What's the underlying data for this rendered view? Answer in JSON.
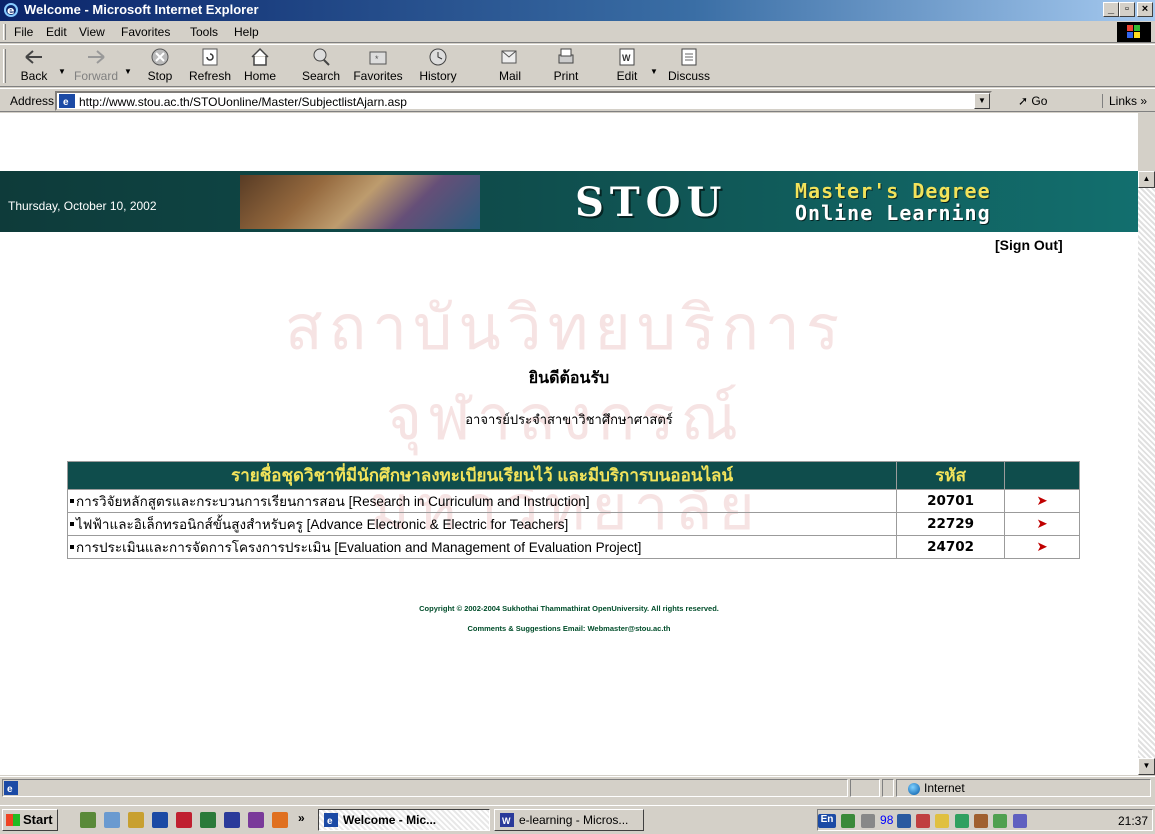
{
  "window": {
    "title": "Welcome - Microsoft Internet Explorer",
    "controls": {
      "minimize": "_",
      "maximize": "▫",
      "close": "×"
    }
  },
  "menu": [
    "File",
    "Edit",
    "View",
    "Favorites",
    "Tools",
    "Help"
  ],
  "toolbar": {
    "back": "Back",
    "forward": "Forward",
    "stop": "Stop",
    "refresh": "Refresh",
    "home": "Home",
    "search": "Search",
    "favorites": "Favorites",
    "history": "History",
    "mail": "Mail",
    "print": "Print",
    "edit": "Edit",
    "discuss": "Discuss"
  },
  "address": {
    "label": "Address",
    "url": "http://www.stou.ac.th/STOUonline/Master/SubjectlistAjarn.asp",
    "go": "Go",
    "links": "Links"
  },
  "banner": {
    "date": "Thursday, October 10, 2002",
    "brand": "STOU",
    "tagline_1": "Master's Degree",
    "tagline_2": "Online Learning"
  },
  "page": {
    "sign_out": "[Sign Out]",
    "welcome": "ยินดีต้อนรับ",
    "role": "อาจารย์ประจำสาขาวิชาศึกษาศาสตร์",
    "watermark_1": "สถาบันวิทยบริการ",
    "watermark_2": "จุฬาลงกรณ์มหาวิทยาลัย"
  },
  "subjects": {
    "header_title": "รายชื่อชุดวิชาที่มีนักศึกษาลงทะเบียนเรียนไว้ และมีบริการบนออนไลน์",
    "header_code": "รหัส",
    "rows": [
      {
        "name": "การวิจัยหลักสูตรและกระบวนการเรียนการสอน [Research in Curriculum and Instruction]",
        "code": "20701",
        "arrow": "➤"
      },
      {
        "name": "ไฟฟ้าและอิเล็กทรอนิกส์ขั้นสูงสำหรับครู [Advance Electronic & Electric for Teachers]",
        "code": "22729",
        "arrow": "➤"
      },
      {
        "name": "การประเมินและการจัดการโครงการประเมิน [Evaluation and Management of Evaluation Project]",
        "code": "24702",
        "arrow": "➤"
      }
    ]
  },
  "footer": {
    "copyright": "Copyright © 2002-2004 Sukhothai Thammathirat OpenUniversity. All rights reserved.",
    "contact": "Comments & Suggestions Email: Webmaster@stou.ac.th"
  },
  "status": {
    "zone": "Internet"
  },
  "taskbar": {
    "start": "Start",
    "more": "»",
    "tasks": [
      "Welcome - Mic...",
      "e-learning - Micros..."
    ],
    "lang": "En",
    "tray_number": "98",
    "clock": "21:37"
  },
  "colors": {
    "banner_bg": "#0f4d4c",
    "banner_yellow": "#f2e35b",
    "arrow_red": "#c00000",
    "footer_green": "#004d2a"
  }
}
